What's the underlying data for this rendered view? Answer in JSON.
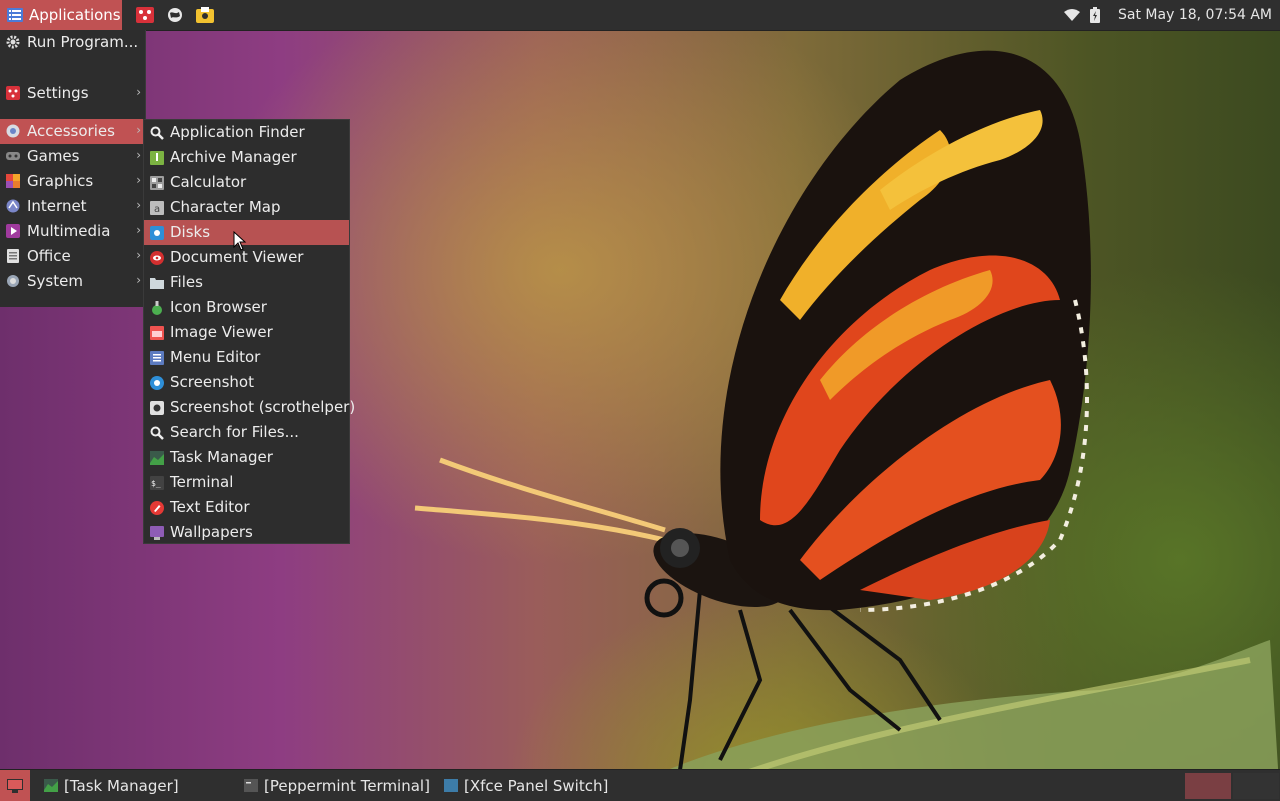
{
  "top_panel": {
    "applications_label": "Applications",
    "clock": "Sat May 18, 07:54 AM",
    "launchers": [
      "ice-icon",
      "browser-icon",
      "files-icon"
    ],
    "tray": [
      "wifi-icon",
      "battery-icon"
    ]
  },
  "main_menu": {
    "items": [
      {
        "label": "Run Program...",
        "icon": "gear-icon",
        "submenu": false
      },
      {
        "label": "Settings",
        "icon": "settings-icon",
        "submenu": true
      },
      {
        "label": "Accessories",
        "icon": "accessories-icon",
        "submenu": true,
        "active": true
      },
      {
        "label": "Games",
        "icon": "games-icon",
        "submenu": true
      },
      {
        "label": "Graphics",
        "icon": "graphics-icon",
        "submenu": true
      },
      {
        "label": "Internet",
        "icon": "internet-icon",
        "submenu": true
      },
      {
        "label": "Multimedia",
        "icon": "multimedia-icon",
        "submenu": true
      },
      {
        "label": "Office",
        "icon": "office-icon",
        "submenu": true
      },
      {
        "label": "System",
        "icon": "system-icon",
        "submenu": true
      }
    ]
  },
  "accessories_menu": {
    "items": [
      {
        "label": "Application Finder",
        "icon": "search-icon"
      },
      {
        "label": "Archive Manager",
        "icon": "archive-icon"
      },
      {
        "label": "Calculator",
        "icon": "calculator-icon"
      },
      {
        "label": "Character Map",
        "icon": "character-map-icon"
      },
      {
        "label": "Disks",
        "icon": "disks-icon",
        "active": true
      },
      {
        "label": "Document Viewer",
        "icon": "document-viewer-icon"
      },
      {
        "label": "Files",
        "icon": "folder-icon"
      },
      {
        "label": "Icon Browser",
        "icon": "icon-browser-icon"
      },
      {
        "label": "Image Viewer",
        "icon": "image-viewer-icon"
      },
      {
        "label": "Menu Editor",
        "icon": "menu-editor-icon"
      },
      {
        "label": "Screenshot",
        "icon": "screenshot-icon"
      },
      {
        "label": "Screenshot (scrothelper)",
        "icon": "screenshot-helper-icon"
      },
      {
        "label": "Search for Files...",
        "icon": "search-files-icon"
      },
      {
        "label": "Task Manager",
        "icon": "task-manager-icon"
      },
      {
        "label": "Terminal",
        "icon": "terminal-icon"
      },
      {
        "label": "Text Editor",
        "icon": "text-editor-icon"
      },
      {
        "label": "Wallpapers",
        "icon": "wallpapers-icon"
      }
    ]
  },
  "taskbar": {
    "tasks": [
      {
        "label": "[Task Manager]",
        "icon": "task-manager-icon"
      },
      {
        "label": "[Peppermint Terminal]",
        "icon": "terminal-icon"
      },
      {
        "label": "[Xfce Panel Switch]",
        "icon": "panel-switch-icon"
      }
    ],
    "workspaces": 2,
    "active_workspace": 1
  },
  "colors": {
    "accent": "#c05253",
    "panel": "#2f2f2f",
    "menu": "#2d2d2d"
  }
}
